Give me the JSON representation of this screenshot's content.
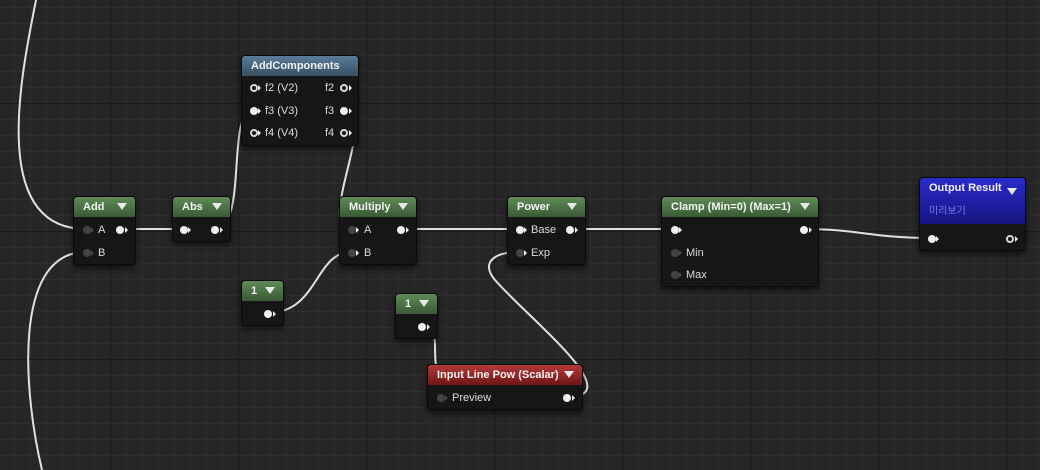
{
  "nodes": {
    "add": {
      "title": "Add",
      "inputs": [
        "A",
        "B"
      ]
    },
    "abs": {
      "title": "Abs"
    },
    "add_components": {
      "title": "AddComponents",
      "inputs": [
        "f2 (V2)",
        "f3 (V3)",
        "f4 (V4)"
      ],
      "outputs": [
        "f2",
        "f3",
        "f4"
      ]
    },
    "multiply": {
      "title": "Multiply",
      "inputs": [
        "A",
        "B"
      ]
    },
    "constant_a": {
      "title": "1"
    },
    "constant_b": {
      "title": "1"
    },
    "power": {
      "title": "Power",
      "inputs": [
        "Base",
        "Exp"
      ]
    },
    "clamp": {
      "title": "Clamp (Min=0) (Max=1)",
      "inputs": [
        "Min",
        "Max"
      ]
    },
    "output_result": {
      "title": "Output Result",
      "subtitle": "미리보기"
    },
    "input_line_pow": {
      "title": "Input Line Pow (Scalar)",
      "outputs": [
        "Preview"
      ]
    }
  },
  "colors": {
    "canvas": "#262626",
    "wire": "#e0e0e0",
    "math_header": "#4a7243",
    "component_header": "#48657e",
    "parameter_header": "#962828",
    "output_header": "#1e1eb0"
  }
}
